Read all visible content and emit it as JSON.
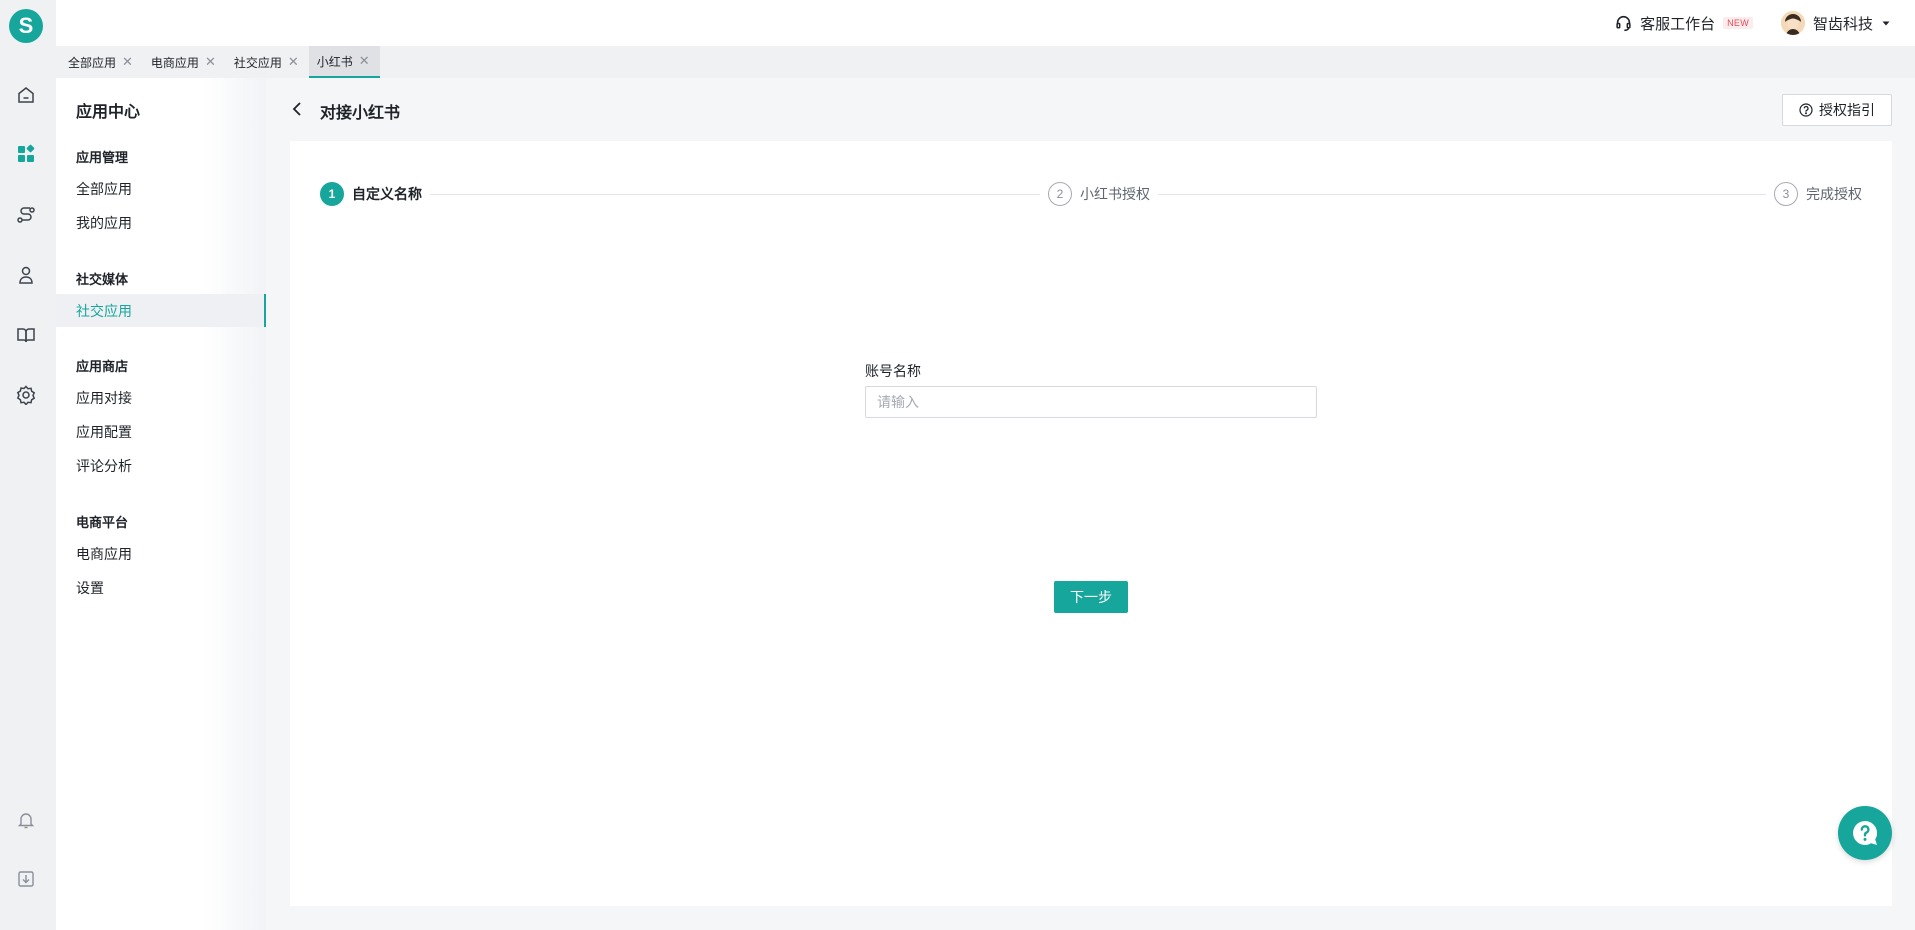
{
  "rail": {
    "logo_letter": "S",
    "icons": [
      "home-icon",
      "apps-icon",
      "flow-icon",
      "users-icon",
      "book-icon",
      "settings-icon",
      "bell-icon",
      "download-icon"
    ],
    "active_icon": "apps-icon"
  },
  "header": {
    "service_label": "客服工作台",
    "service_badge": "NEW",
    "company_name": "智齿科技"
  },
  "tabs": [
    {
      "label": "全部应用",
      "active": false
    },
    {
      "label": "电商应用",
      "active": false
    },
    {
      "label": "社交应用",
      "active": false
    },
    {
      "label": "小红书",
      "active": true
    }
  ],
  "sidebar": {
    "title": "应用中心",
    "groups": [
      {
        "label": "应用管理",
        "items": [
          {
            "label": "全部应用"
          },
          {
            "label": "我的应用"
          }
        ]
      },
      {
        "label": "社交媒体",
        "items": [
          {
            "label": "社交应用",
            "active": true
          }
        ]
      },
      {
        "label": "应用商店",
        "items": [
          {
            "label": "应用对接"
          },
          {
            "label": "应用配置"
          },
          {
            "label": "评论分析"
          }
        ]
      },
      {
        "label": "电商平台",
        "items": [
          {
            "label": "电商应用"
          },
          {
            "label": "设置"
          }
        ]
      }
    ]
  },
  "page": {
    "title": "对接小红书",
    "guide_label": "授权指引"
  },
  "steps": [
    {
      "num": "1",
      "label": "自定义名称",
      "active": true
    },
    {
      "num": "2",
      "label": "小红书授权",
      "active": false
    },
    {
      "num": "3",
      "label": "完成授权",
      "active": false
    }
  ],
  "form": {
    "account_label": "账号名称",
    "account_placeholder": "请输入",
    "account_value": ""
  },
  "next_label": "下一步",
  "colors": {
    "accent": "#17a69c",
    "text": "#1f2329",
    "muted": "#8a8f99"
  }
}
